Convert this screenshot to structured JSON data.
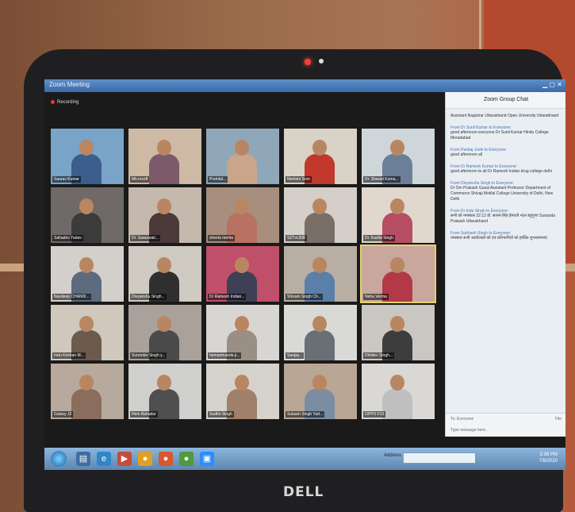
{
  "window": {
    "title": "Zoom Meeting",
    "recording": "Recording"
  },
  "participants": [
    {
      "name": "Saurav Kumar",
      "bg": "#7aa3c8",
      "shirt": "#3c5e8c"
    },
    {
      "name": "Microsoft",
      "bg": "#cdb9a4",
      "shirt": "#7c5a6a"
    },
    {
      "name": "Premlal...",
      "bg": "#8fa7b8",
      "shirt": "#caa58a"
    },
    {
      "name": "Neelam Soni",
      "bg": "#d9d2c6",
      "shirt": "#c0392b"
    },
    {
      "name": "Dr. Sharad Kuma...",
      "bg": "#cfd6d9",
      "shirt": "#6b7f99"
    },
    {
      "name": "Sahadev Yadav",
      "bg": "#6f6a67",
      "shirt": "#3b3b3b"
    },
    {
      "name": "Dr. Saraswati...",
      "bg": "#c5b8ad",
      "shirt": "#4b3a3a"
    },
    {
      "name": "sheela mehta",
      "bg": "#a88f7d",
      "shirt": "#b77262"
    },
    {
      "name": "SZTvc308",
      "bg": "#d4cfc9",
      "shirt": "#7a6f66"
    },
    {
      "name": "Dr. Kavita Singh",
      "bg": "#e0d7cd",
      "shirt": "#b64d62"
    },
    {
      "name": "Navdeep CHANDI...",
      "bg": "#d3d0cb",
      "shirt": "#5c6b7d"
    },
    {
      "name": "Divyanshu Singh...",
      "bg": "#cfcac2",
      "shirt": "#2f2f2f"
    },
    {
      "name": "Dr Ramesh Indian...",
      "bg": "#c04f6a",
      "shirt": "#3f3f55"
    },
    {
      "name": "Shivam Singh Ch...",
      "bg": "#b8aea3",
      "shirt": "#5a7fa8"
    },
    {
      "name": "Neha Verma",
      "bg": "#c9a79e",
      "shirt": "#b23a48"
    },
    {
      "name": "Indu Krishan M...",
      "bg": "#d0c7bd",
      "shirt": "#6c5a4d"
    },
    {
      "name": "Surender Singh y...",
      "bg": "#a9a19a",
      "shirt": "#4a4a4a"
    },
    {
      "name": "hemantnanda ji...",
      "bg": "#d8d6d3",
      "shirt": "#9a8f84"
    },
    {
      "name": "Sanjay...",
      "bg": "#d9dad6",
      "shirt": "#6a6f75"
    },
    {
      "name": "Dhildev Singh...",
      "bg": "#cac6c1",
      "shirt": "#3d3d3d"
    },
    {
      "name": "Galaxy J2",
      "bg": "#b7a99d",
      "shirt": "#8a6d5c"
    },
    {
      "name": "Hem Bahadur",
      "bg": "#cfcfcd",
      "shirt": "#4f4f4f"
    },
    {
      "name": "Sudhir Singh",
      "bg": "#d6d2cc",
      "shirt": "#a0806a"
    },
    {
      "name": "Subash Singh Yad...",
      "bg": "#b9a695",
      "shirt": "#7b8da3"
    },
    {
      "name": "OPPO F13",
      "bg": "#d9d8d4",
      "shirt": "#bfbfbf"
    }
  ],
  "chat": {
    "title": "Zoom Group Chat",
    "messages": [
      {
        "from": "",
        "text": "Assistant Ragistrar Uttarakhand Open University Uttarakhand"
      },
      {
        "from": "From Dr Sunil Kumar to Everyone:",
        "text": "good afternoon everyone Dr Sunil Kumar Hindu College Moradabad"
      },
      {
        "from": "From Pankaj Joshi to Everyone:",
        "text": "good afternoon all"
      },
      {
        "from": "From Dr Ramesh Kumar to Everyone:",
        "text": "good afternoon to all Dr Ramesh Indian drug college delhi"
      },
      {
        "from": "From Divyanshu Singh to Everyone:",
        "text": "Dr Om Prakash Gusai Assistant Professor Department of Commerce Shivaji Motilal College University of Delhi, New Delhi"
      },
      {
        "from": "From Dr Indu Singh to Everyone:",
        "text": "सभी को नमस्कार 22:12 डॉ. सत्यम सिंह हेमवती नंदन बहुगुणा Sunanda Prakash Uttarakhand"
      },
      {
        "from": "From Subhash Singh to Everyone:",
        "text": "नमस्कार सभी आयोजकों को एवं प्रतिभागियों को हार्दिक शुभकामनाएं"
      }
    ],
    "footer_to": "To: Everyone",
    "footer_file": "File",
    "footer_placeholder": "Type message here..."
  },
  "taskbar": {
    "address_label": "Address",
    "time": "2:38 PM",
    "date": "7/8/2020"
  },
  "brand": "DELL"
}
